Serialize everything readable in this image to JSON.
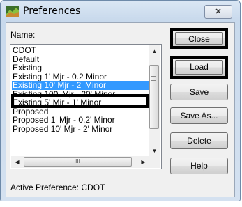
{
  "window": {
    "title": "Preferences",
    "close_glyph": "✕"
  },
  "name_label": "Name:",
  "list": {
    "items": [
      "CDOT",
      "Default",
      "Existing",
      "Existing 1' Mjr - 0.2 Minor",
      "Existing 10' Mjr - 2' Minor",
      "Existing 100' Mjr - 20' Minor",
      "Existing 5' Mjr - 1' Minor",
      "Proposed",
      "Proposed 1' Mjr - 0.2' Minor",
      "Proposed 10' Mjr - 2' Minor"
    ],
    "selected_index": 4
  },
  "buttons": {
    "close": "Close",
    "load": "Load",
    "save": "Save",
    "save_as": "Save As...",
    "delete": "Delete",
    "help": "Help"
  },
  "status": "Active Preference: CDOT",
  "icons": {
    "app": "preferences-icon",
    "scroll_up": "▲",
    "scroll_down": "▼",
    "scroll_left": "◀",
    "scroll_right": "▶",
    "grip": "III"
  },
  "colors": {
    "selection": "#3399ff",
    "annotation_box": "#000000"
  }
}
